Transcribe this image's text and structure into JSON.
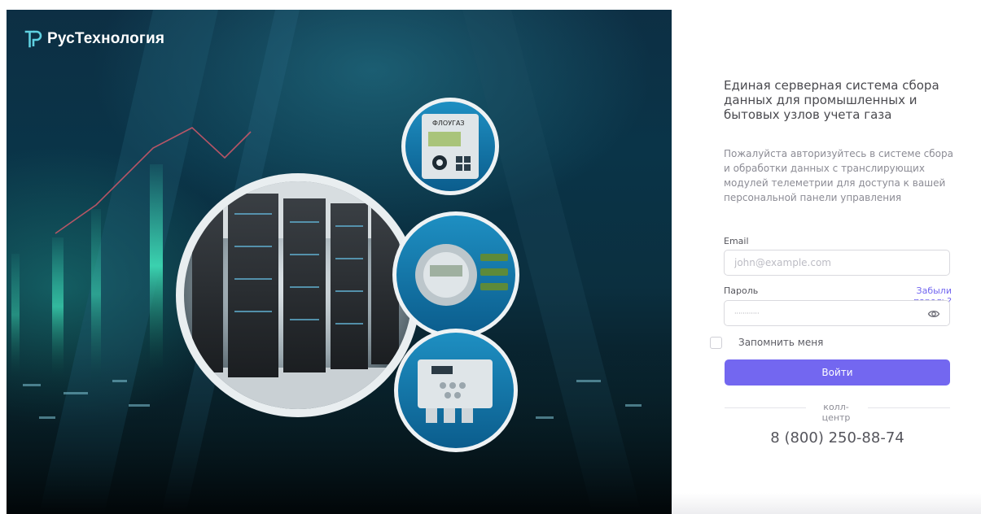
{
  "brand": {
    "name": "РусТехнология",
    "accent": "#7367f0"
  },
  "login": {
    "title": "Единая серверная система сбора данных для промышленных и бытовых узлов учета газа",
    "description": "Пожалуйста авторизуйтесь в системе сбора и обработки данных с транслирующих модулей телеметрии для доступа к вашей персональной панели управления",
    "email_label": "Email",
    "email_placeholder": "john@example.com",
    "password_label": "Пароль",
    "forgot_label": "Забыли пароль?",
    "password_value": "············",
    "remember_label": "Запомнить меня",
    "submit_label": "Войти",
    "callcenter_label": "колл-центр",
    "phone": "8 (800) 250-88-74"
  },
  "hero": {
    "device_display_text": "ФЛОУГАЗ"
  },
  "icons": {
    "logo": "rt-logo-icon",
    "password_toggle": "eye-icon"
  }
}
